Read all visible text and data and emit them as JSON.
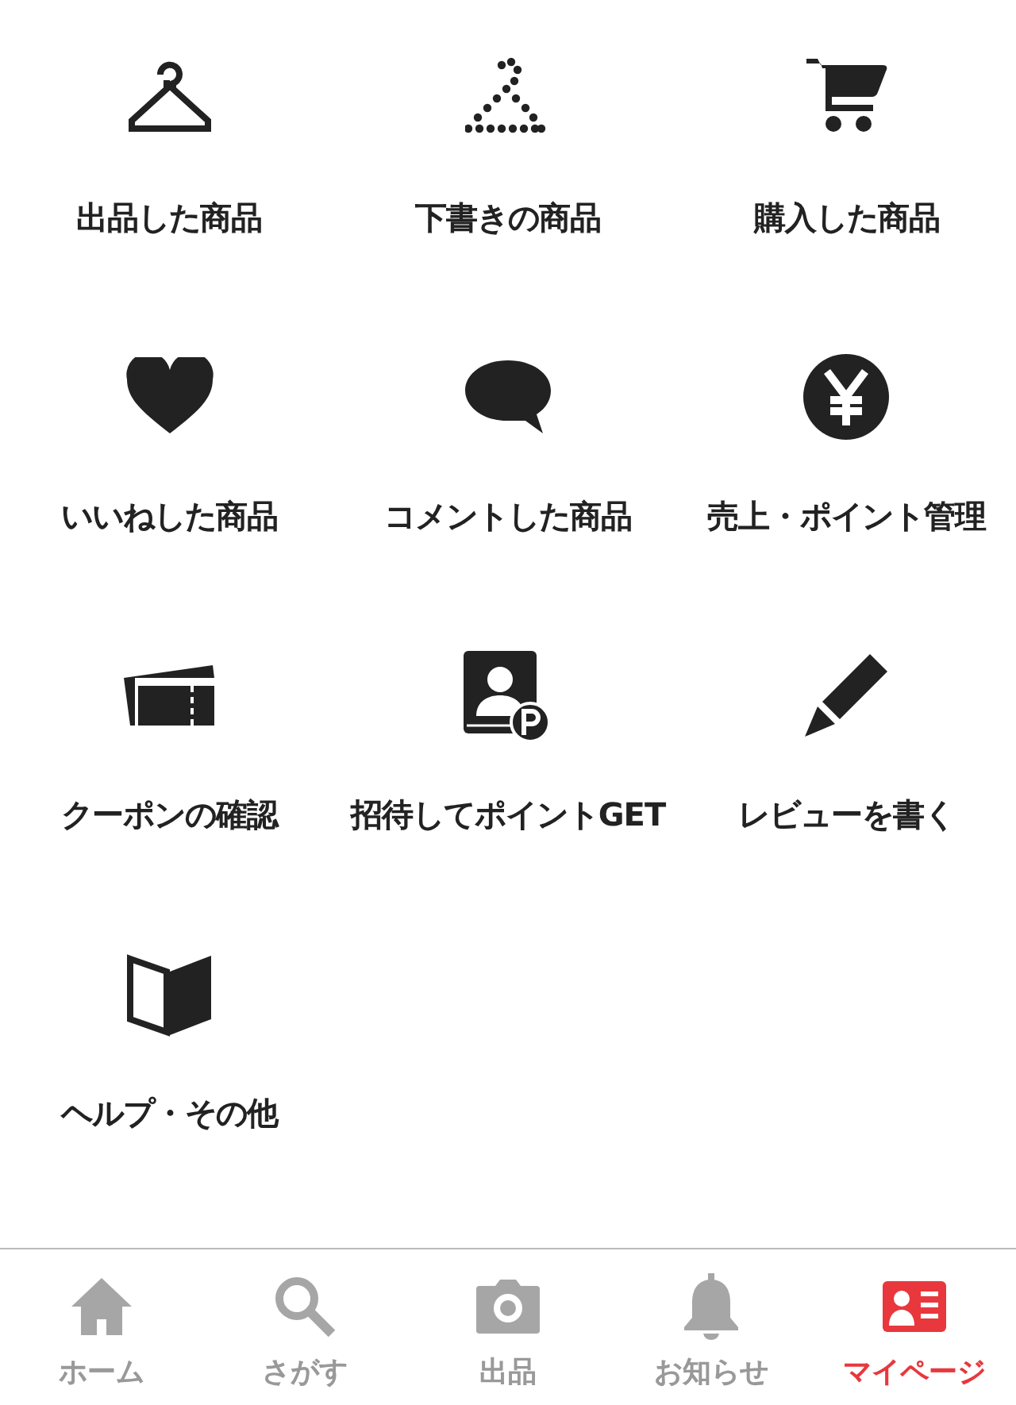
{
  "menu": [
    {
      "kind": "hanger",
      "label": "出品した商品"
    },
    {
      "kind": "dotted-hanger",
      "label": "下書きの商品"
    },
    {
      "kind": "cart",
      "label": "購入した商品"
    },
    {
      "kind": "heart",
      "label": "いいねした商品"
    },
    {
      "kind": "comment",
      "label": "コメントした商品"
    },
    {
      "kind": "yen",
      "label": "売上・ポイント管理"
    },
    {
      "kind": "ticket",
      "label": "クーポンの確認"
    },
    {
      "kind": "invite",
      "label": "招待してポイントGET"
    },
    {
      "kind": "pencil",
      "label": "レビューを書く"
    },
    {
      "kind": "book",
      "label": "ヘルプ・その他"
    }
  ],
  "tab_bar": [
    {
      "kind": "home",
      "label": "ホーム",
      "selected": false
    },
    {
      "kind": "search",
      "label": "さがす",
      "selected": false
    },
    {
      "kind": "camera",
      "label": "出品",
      "selected": false
    },
    {
      "kind": "bell",
      "label": "お知らせ",
      "selected": false
    },
    {
      "kind": "profile",
      "label": "マイページ",
      "selected": true
    }
  ]
}
